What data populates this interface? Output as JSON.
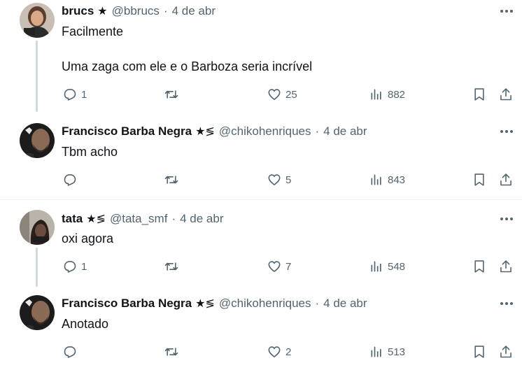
{
  "tweets": [
    {
      "name": "brucs",
      "badge": "★",
      "handle": "@bbrucs",
      "date": "4 de abr",
      "lines": [
        "Facilmente",
        "Uma zaga com ele e o Barboza seria incrível"
      ],
      "replies": "1",
      "retweets": "",
      "likes": "25",
      "views": "882"
    },
    {
      "name": "Francisco Barba Negra",
      "badge": "★≶",
      "handle": "@chikohenriques",
      "date": "4 de abr",
      "lines": [
        "Tbm acho"
      ],
      "replies": "",
      "retweets": "",
      "likes": "5",
      "views": "843"
    },
    {
      "name": "tata",
      "badge": "★≶",
      "handle": "@tata_smf",
      "date": "4 de abr",
      "lines": [
        "oxi agora"
      ],
      "replies": "1",
      "retweets": "",
      "likes": "7",
      "views": "548"
    },
    {
      "name": "Francisco Barba Negra",
      "badge": "★≶",
      "handle": "@chikohenriques",
      "date": "4 de abr",
      "lines": [
        "Anotado"
      ],
      "replies": "",
      "retweets": "",
      "likes": "2",
      "views": "513"
    }
  ],
  "separator": "·",
  "icons": {
    "reply": "reply-icon",
    "retweet": "retweet-icon",
    "like": "heart-icon",
    "views": "views-icon",
    "bookmark": "bookmark-icon",
    "share": "share-icon",
    "more": "more-icon"
  },
  "colors": {
    "text": "#0f1419",
    "secondary": "#536471",
    "divider": "#eff3f4",
    "thread": "#cfd9de"
  }
}
